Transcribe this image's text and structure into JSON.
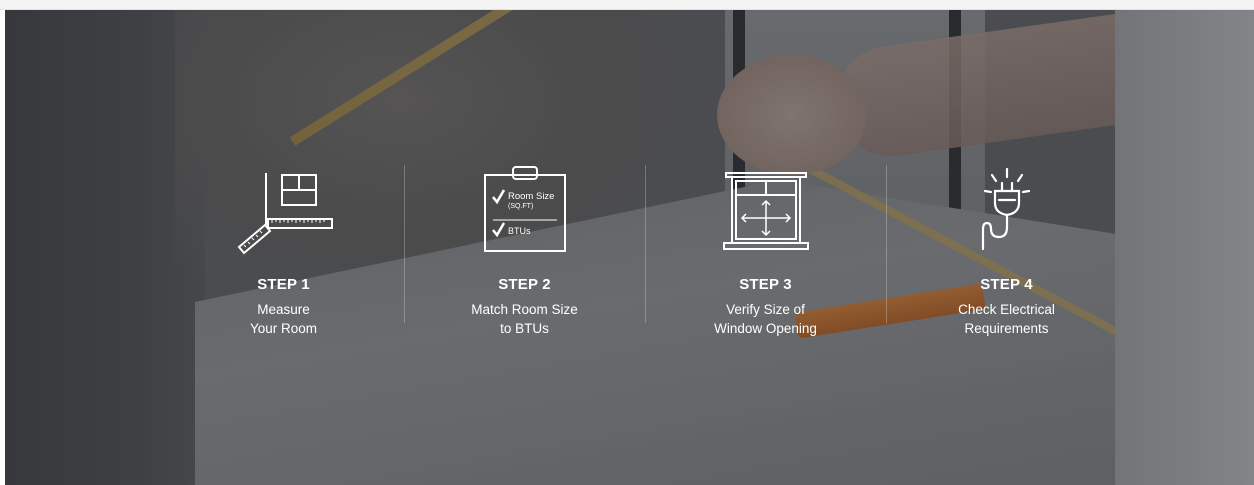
{
  "steps": [
    {
      "icon": "measure-room-icon",
      "title": "STEP 1",
      "desc_line1": "Measure",
      "desc_line2": "Your Room"
    },
    {
      "icon": "clipboard-checklist-icon",
      "title": "STEP 2",
      "desc_line1": "Match Room Size",
      "desc_line2": "to BTUs",
      "icon_labels": {
        "room_size": "Room Size",
        "sqft": "(SQ.FT)",
        "btus": "BTUs"
      }
    },
    {
      "icon": "window-size-icon",
      "title": "STEP 3",
      "desc_line1": "Verify Size of",
      "desc_line2": "Window Opening"
    },
    {
      "icon": "electrical-plug-icon",
      "title": "STEP 4",
      "desc_line1": "Check Electrical",
      "desc_line2": "Requirements"
    }
  ],
  "colors": {
    "text": "#ffffff",
    "overlay": "#3c3e42"
  }
}
